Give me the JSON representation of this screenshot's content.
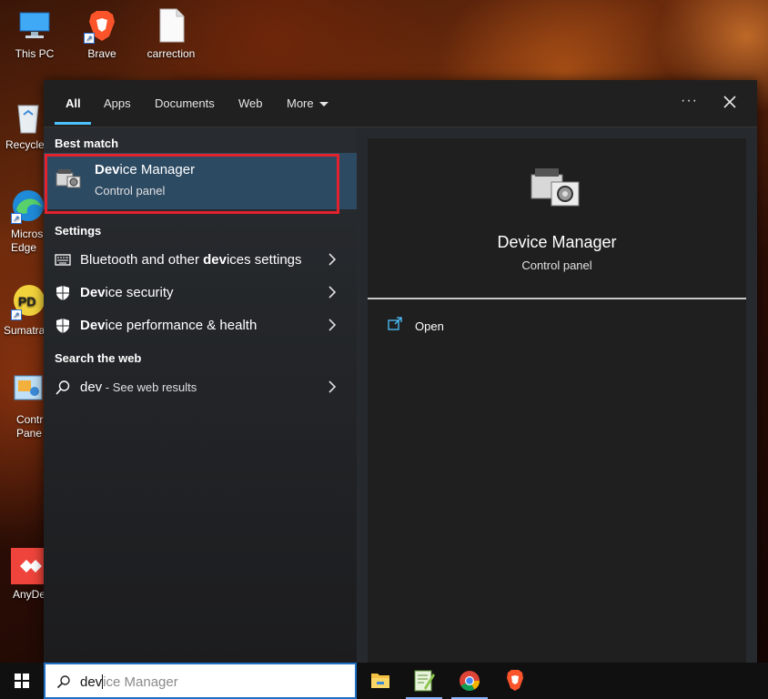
{
  "desktop": {
    "icons": [
      {
        "label": "This PC",
        "icon": "computer-icon"
      },
      {
        "label": "Brave",
        "icon": "brave-icon"
      },
      {
        "label": "carrection",
        "icon": "document-icon"
      },
      {
        "label": "Recycle",
        "icon": "recycle-bin-icon"
      },
      {
        "label": "Micros\nEdge",
        "icon": "edge-icon"
      },
      {
        "label": "Sumatra",
        "icon": "sumatra-pdf-icon"
      },
      {
        "label": "Contr\nPane",
        "icon": "control-panel-icon"
      },
      {
        "label": "AnyDe",
        "icon": "anydesk-icon"
      }
    ]
  },
  "search": {
    "tabs": [
      "All",
      "Apps",
      "Documents",
      "Web",
      "More"
    ],
    "active_tab": "All",
    "more_icon": "chevron-down-icon",
    "options_label": "···",
    "best_match_label": "Best match",
    "best_match": {
      "title_bold": "Dev",
      "title_rest": "ice Manager",
      "subtitle": "Control panel",
      "icon": "device-manager-icon"
    },
    "settings_label": "Settings",
    "settings_items": [
      {
        "pre": "Bluetooth and other ",
        "bold": "dev",
        "post": "ices settings",
        "icon": "bluetooth-devices-icon"
      },
      {
        "pre": "",
        "bold": "Dev",
        "post": "ice security",
        "icon": "shield-icon"
      },
      {
        "pre": "",
        "bold": "Dev",
        "post": "ice performance & health",
        "icon": "shield-icon"
      }
    ],
    "web_label": "Search the web",
    "web_item": {
      "query": "dev",
      "suffix": " - See web results",
      "icon": "search-icon"
    }
  },
  "detail": {
    "title": "Device Manager",
    "subtitle": "Control panel",
    "actions": [
      {
        "label": "Open",
        "icon": "open-window-icon"
      }
    ]
  },
  "taskbar": {
    "search_typed": "dev",
    "search_suggestion": "ice Manager",
    "apps": [
      {
        "name": "File Explorer",
        "icon": "file-explorer-icon"
      },
      {
        "name": "Notepad++",
        "icon": "notepad-plus-icon"
      },
      {
        "name": "Chrome",
        "icon": "chrome-icon"
      },
      {
        "name": "Brave",
        "icon": "brave-icon"
      }
    ]
  }
}
